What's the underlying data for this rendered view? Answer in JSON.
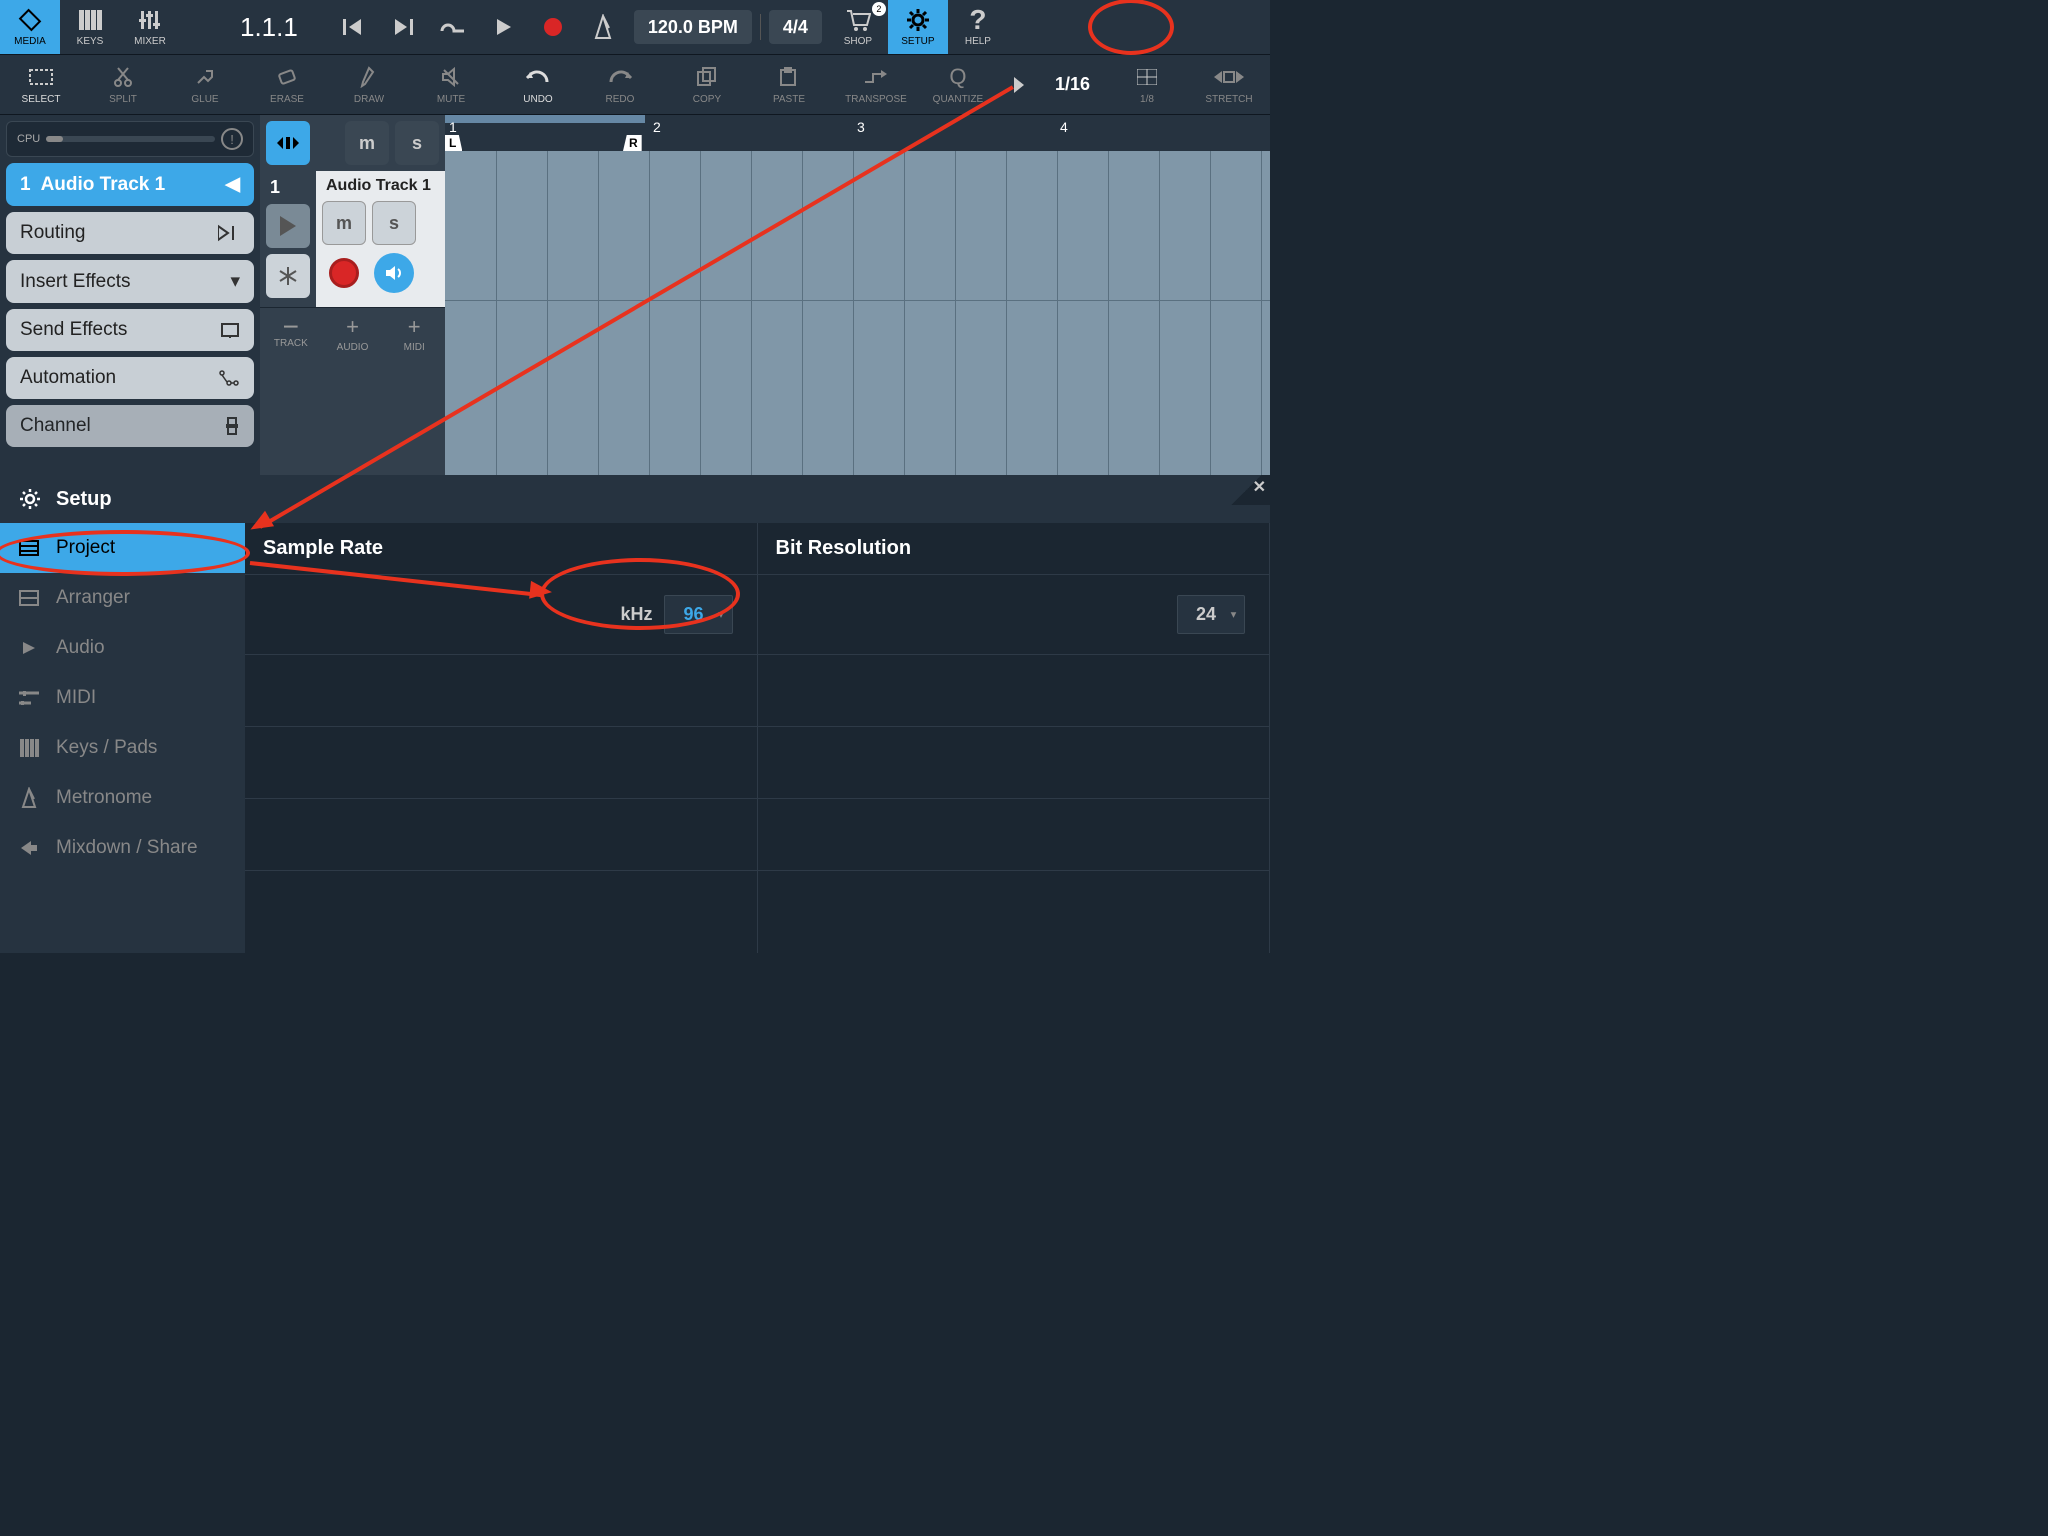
{
  "top": {
    "media": "MEDIA",
    "keys": "KEYS",
    "mixer": "MIXER",
    "position": "1.1.1",
    "tempo": "120.0 BPM",
    "signature": "4/4",
    "shop": "SHOP",
    "shop_badge": "2",
    "setup": "SETUP",
    "help": "HELP"
  },
  "tools": {
    "select": "SELECT",
    "split": "SPLIT",
    "glue": "GLUE",
    "erase": "ERASE",
    "draw": "DRAW",
    "mute": "MUTE",
    "undo": "UNDO",
    "redo": "REDO",
    "copy": "COPY",
    "paste": "PASTE",
    "transpose": "TRANSPOSE",
    "quantize": "QUANTIZE",
    "grid1": "1/16",
    "grid2": "1/8",
    "stretch": "STRETCH"
  },
  "left": {
    "cpu": "CPU",
    "track_num": "1",
    "track_name": "Audio Track 1",
    "routing": "Routing",
    "insert_fx": "Insert Effects",
    "send_fx": "Send Effects",
    "automation": "Automation",
    "channel": "Channel"
  },
  "track": {
    "m": "m",
    "s": "s",
    "number": "1",
    "name": "Audio Track 1",
    "add_track": "TRACK",
    "add_audio": "AUDIO",
    "add_midi": "MIDI"
  },
  "ruler": {
    "m1": "1",
    "m2": "2",
    "m3": "3",
    "m4": "4",
    "L": "L",
    "R": "R"
  },
  "setup": {
    "title": "Setup",
    "nav": {
      "project": "Project",
      "arranger": "Arranger",
      "audio": "Audio",
      "midi": "MIDI",
      "keys": "Keys / Pads",
      "metronome": "Metronome",
      "mixdown": "Mixdown / Share"
    },
    "sample_rate_label": "Sample Rate",
    "sample_rate_unit": "kHz",
    "sample_rate_value": "96",
    "bit_res_label": "Bit Resolution",
    "bit_res_value": "24"
  }
}
